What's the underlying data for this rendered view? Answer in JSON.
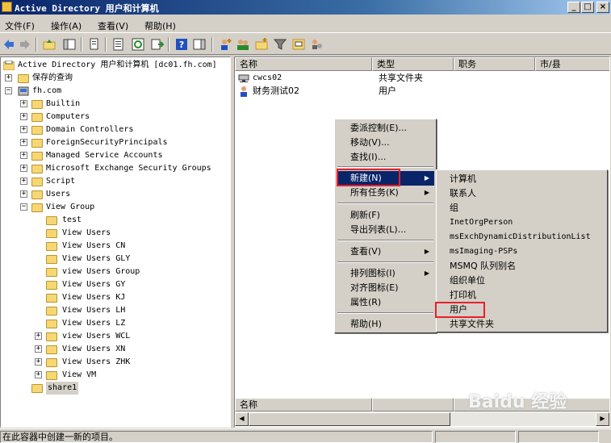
{
  "window": {
    "title": "Active Directory 用户和计算机"
  },
  "menubar": {
    "items": [
      "文件(F)",
      "操作(A)",
      "查看(V)",
      "帮助(H)"
    ]
  },
  "tree": {
    "root": "Active Directory 用户和计算机 [dc01.fh.com]",
    "saved_queries": "保存的查询",
    "domain": "fh.com",
    "containers": [
      "Builtin",
      "Computers",
      "Domain Controllers",
      "ForeignSecurityPrincipals",
      "Managed Service Accounts",
      "Microsoft Exchange Security Groups",
      "Script",
      "Users"
    ],
    "view_group": "View Group",
    "view_group_children": [
      "test",
      "View Users",
      "View Users CN",
      "View Users GLY",
      "view Users Group",
      "View Users GY",
      "View Users KJ",
      "View Users LH",
      "View Users LZ",
      "view Users WCL",
      "View Users XN",
      "View Users ZHK",
      "View VM"
    ],
    "share": "share1"
  },
  "list": {
    "columns": [
      "名称",
      "类型",
      "职务",
      "市/县"
    ],
    "rows": [
      {
        "name": "cwcs02",
        "type": "共享文件夹"
      },
      {
        "name": "财务测试02",
        "type": "用户"
      }
    ]
  },
  "context_menu": {
    "items": [
      "委派控制(E)...",
      "移动(V)...",
      "查找(I)...",
      "新建(N)",
      "所有任务(K)",
      "刷新(F)",
      "导出列表(L)...",
      "查看(V)",
      "排列图标(I)",
      "对齐图标(E)",
      "属性(R)",
      "帮助(H)"
    ]
  },
  "submenu": {
    "items": [
      "计算机",
      "联系人",
      "组",
      "InetOrgPerson",
      "msExchDynamicDistributionList",
      "msImaging-PSPs",
      "MSMQ 队列别名",
      "组织单位",
      "打印机",
      "用户",
      "共享文件夹"
    ]
  },
  "status": {
    "text": "在此容器中创建一新的项目。"
  },
  "watermark": {
    "text": "Baidu 经验"
  }
}
